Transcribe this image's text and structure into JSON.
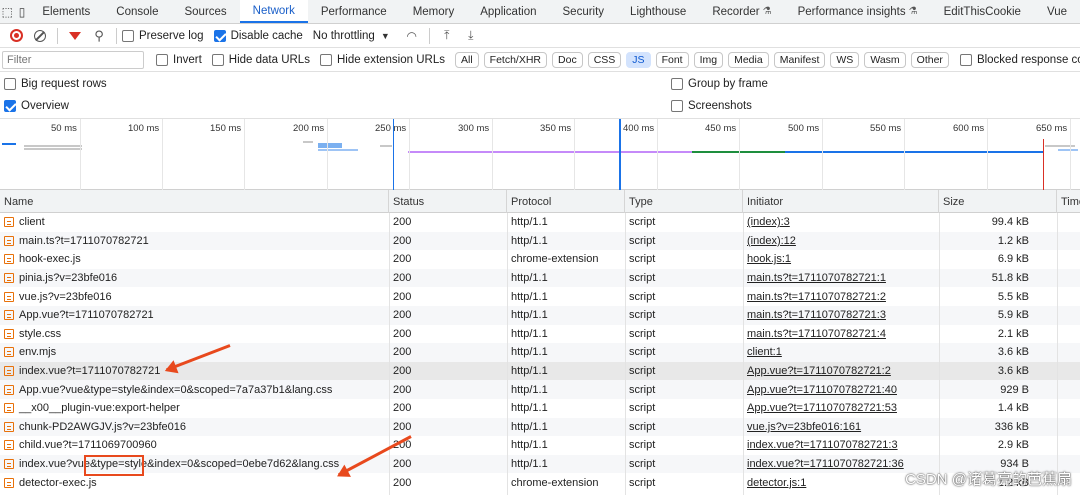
{
  "tabs": [
    "Elements",
    "Console",
    "Sources",
    "Network",
    "Performance",
    "Memory",
    "Application",
    "Security",
    "Lighthouse",
    "Recorder",
    "Performance insights",
    "EditThisCookie",
    "Vue"
  ],
  "toolbar": {
    "preserve_log": "Preserve log",
    "disable_cache": "Disable cache",
    "throttling": "No throttling"
  },
  "filter": {
    "placeholder": "Filter",
    "invert": "Invert",
    "hide_data_urls": "Hide data URLs",
    "hide_extension_urls": "Hide extension URLs",
    "types": [
      "All",
      "Fetch/XHR",
      "Doc",
      "CSS",
      "JS",
      "Font",
      "Img",
      "Media",
      "Manifest",
      "WS",
      "Wasm",
      "Other"
    ],
    "selected_type": "JS",
    "blocked_cookies": "Blocked response cookies"
  },
  "options": {
    "big_request_rows": "Big request rows",
    "group_by_frame": "Group by frame",
    "overview": "Overview",
    "screenshots": "Screenshots"
  },
  "timeline": {
    "ticks": [
      "50 ms",
      "100 ms",
      "150 ms",
      "200 ms",
      "250 ms",
      "300 ms",
      "350 ms",
      "400 ms",
      "450 ms",
      "500 ms",
      "550 ms",
      "600 ms",
      "650 ms"
    ]
  },
  "table": {
    "headers": {
      "name": "Name",
      "status": "Status",
      "protocol": "Protocol",
      "type": "Type",
      "initiator": "Initiator",
      "size": "Size",
      "time": "Time"
    },
    "rows": [
      {
        "name": "client",
        "status": "200",
        "protocol": "http/1.1",
        "type": "script",
        "initiator": "(index):3",
        "size": "99.4 kB"
      },
      {
        "name": "main.ts?t=1711070782721",
        "status": "200",
        "protocol": "http/1.1",
        "type": "script",
        "initiator": "(index):12",
        "size": "1.2 kB"
      },
      {
        "name": "hook-exec.js",
        "status": "200",
        "protocol": "chrome-extension",
        "type": "script",
        "initiator": "hook.js:1",
        "size": "6.9 kB"
      },
      {
        "name": "pinia.js?v=23bfe016",
        "status": "200",
        "protocol": "http/1.1",
        "type": "script",
        "initiator": "main.ts?t=1711070782721:1",
        "size": "51.8 kB"
      },
      {
        "name": "vue.js?v=23bfe016",
        "status": "200",
        "protocol": "http/1.1",
        "type": "script",
        "initiator": "main.ts?t=1711070782721:2",
        "size": "5.5 kB"
      },
      {
        "name": "App.vue?t=1711070782721",
        "status": "200",
        "protocol": "http/1.1",
        "type": "script",
        "initiator": "main.ts?t=1711070782721:3",
        "size": "5.9 kB"
      },
      {
        "name": "style.css",
        "status": "200",
        "protocol": "http/1.1",
        "type": "script",
        "initiator": "main.ts?t=1711070782721:4",
        "size": "2.1 kB"
      },
      {
        "name": "env.mjs",
        "status": "200",
        "protocol": "http/1.1",
        "type": "script",
        "initiator": "client:1",
        "size": "3.6 kB"
      },
      {
        "name": "index.vue?t=1711070782721",
        "status": "200",
        "protocol": "http/1.1",
        "type": "script",
        "initiator": "App.vue?t=1711070782721:2",
        "size": "3.6 kB"
      },
      {
        "name": "App.vue?vue&type=style&index=0&scoped=7a7a37b1&lang.css",
        "status": "200",
        "protocol": "http/1.1",
        "type": "script",
        "initiator": "App.vue?t=1711070782721:40",
        "size": "929 B"
      },
      {
        "name": "__x00__plugin-vue:export-helper",
        "status": "200",
        "protocol": "http/1.1",
        "type": "script",
        "initiator": "App.vue?t=1711070782721:53",
        "size": "1.4 kB"
      },
      {
        "name": "chunk-PD2AWGJV.js?v=23bfe016",
        "status": "200",
        "protocol": "http/1.1",
        "type": "script",
        "initiator": "vue.js?v=23bfe016:161",
        "size": "336 kB"
      },
      {
        "name": "child.vue?t=1711069700960",
        "status": "200",
        "protocol": "http/1.1",
        "type": "script",
        "initiator": "index.vue?t=1711070782721:3",
        "size": "2.9 kB"
      },
      {
        "name": "index.vue?vue&type=style&index=0&scoped=0ebe7d62&lang.css",
        "status": "200",
        "protocol": "http/1.1",
        "type": "script",
        "initiator": "index.vue?t=1711070782721:36",
        "size": "934 B"
      },
      {
        "name": "detector-exec.js",
        "status": "200",
        "protocol": "chrome-extension",
        "type": "script",
        "initiator": "detector.js:1",
        "size": "1.2 kB"
      }
    ]
  },
  "watermark": "CSDN @诸葛亮的芭蕉扇",
  "colors": {
    "accent": "#1a73e8",
    "record": "#d93025",
    "annotation": "#e8491d"
  }
}
